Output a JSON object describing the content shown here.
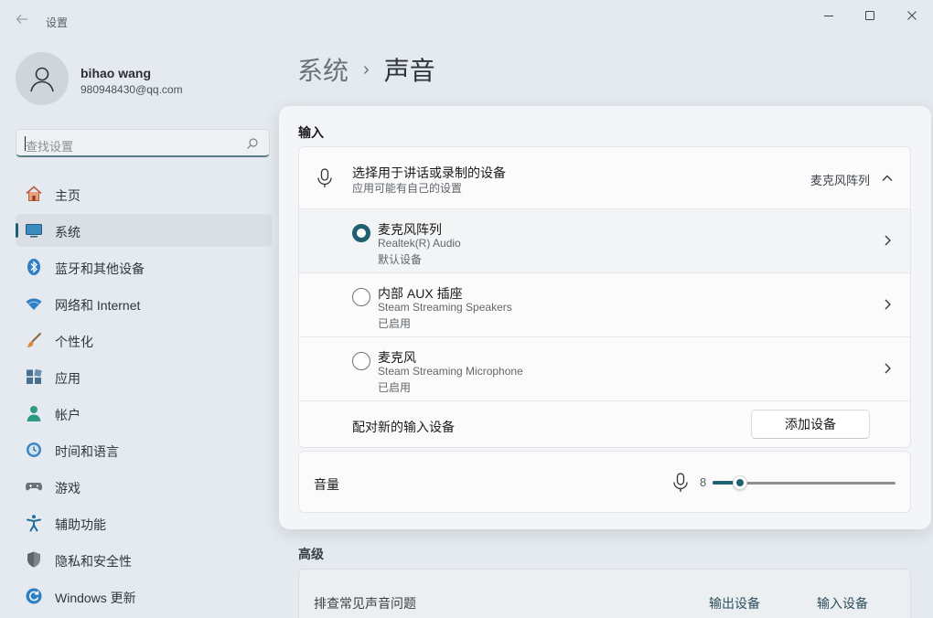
{
  "window": {
    "app_title": "设置",
    "icons": {
      "back": "back-arrow-icon",
      "minimize": "minimize-icon",
      "maximize": "maximize-icon",
      "close": "close-icon"
    }
  },
  "profile": {
    "name": "bihao wang",
    "email": "980948430@qq.com",
    "avatar_icon": "user-icon"
  },
  "search": {
    "placeholder": "查找设置",
    "icon": "search-icon"
  },
  "sidebar": {
    "active_index": 1,
    "items": [
      {
        "label": "主页",
        "icon": "home-icon"
      },
      {
        "label": "系统",
        "icon": "system-icon"
      },
      {
        "label": "蓝牙和其他设备",
        "icon": "bluetooth-icon"
      },
      {
        "label": "网络和 Internet",
        "icon": "wifi-icon"
      },
      {
        "label": "个性化",
        "icon": "brush-icon"
      },
      {
        "label": "应用",
        "icon": "apps-icon"
      },
      {
        "label": "帐户",
        "icon": "account-icon"
      },
      {
        "label": "时间和语言",
        "icon": "time-language-icon"
      },
      {
        "label": "游戏",
        "icon": "gamepad-icon"
      },
      {
        "label": "辅助功能",
        "icon": "accessibility-icon"
      },
      {
        "label": "隐私和安全性",
        "icon": "shield-icon"
      },
      {
        "label": "Windows 更新",
        "icon": "update-icon"
      }
    ]
  },
  "breadcrumb": {
    "parent": "系统",
    "separator": "›",
    "current": "声音"
  },
  "input_section": {
    "heading": "输入",
    "header": {
      "title": "选择用于讲话或录制的设备",
      "subtitle": "应用可能有自己的设置",
      "selected_value": "麦克风阵列"
    },
    "devices": [
      {
        "name": "麦克风阵列",
        "detail": "Realtek(R) Audio",
        "status": "默认设备",
        "selected": true
      },
      {
        "name": "内部 AUX 插座",
        "detail": "Steam Streaming Speakers",
        "status": "已启用",
        "selected": false
      },
      {
        "name": "麦克风",
        "detail": "Steam Streaming Microphone",
        "status": "已启用",
        "selected": false
      }
    ],
    "pair": {
      "label": "配对新的输入设备",
      "button": "添加设备"
    }
  },
  "volume": {
    "label": "音量",
    "value": "8",
    "level": 8,
    "max": 100
  },
  "advanced": {
    "heading": "高级",
    "troubleshoot": {
      "label": "排查常见声音问题",
      "output": "输出设备",
      "input": "输入设备"
    }
  },
  "colors": {
    "accent": "#1f6170",
    "panel_bg": "#f3f5f8",
    "page_bg": "#e4eaef"
  }
}
